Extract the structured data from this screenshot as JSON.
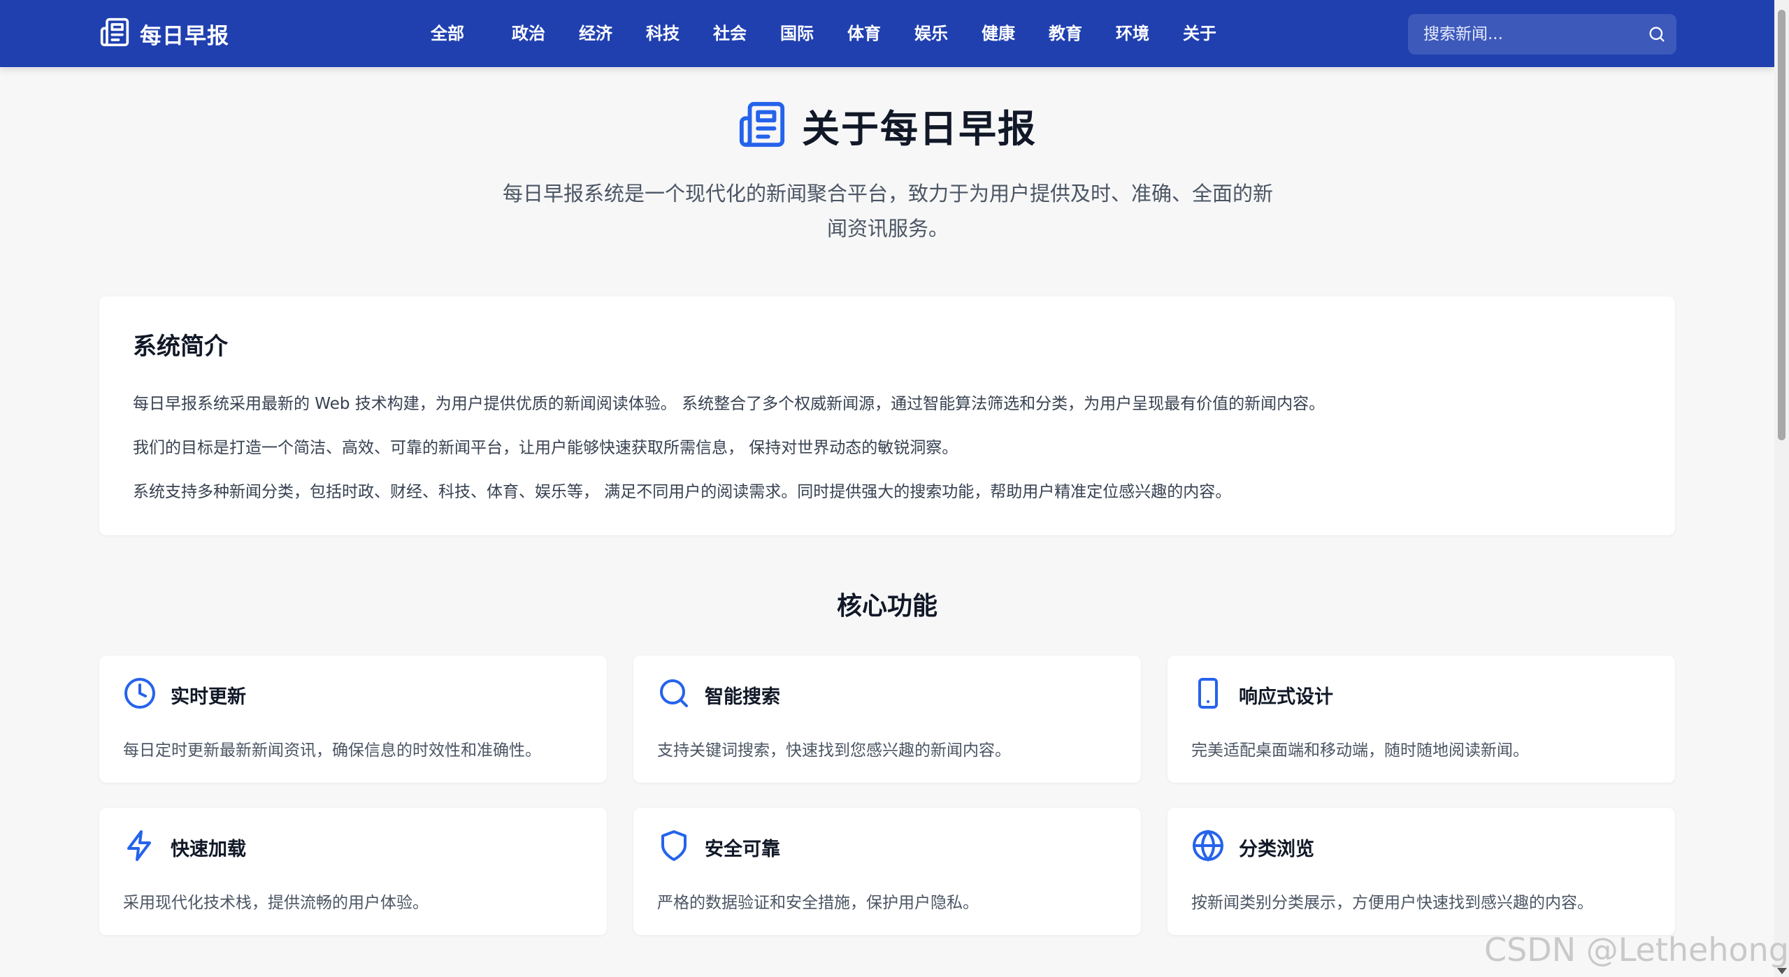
{
  "header": {
    "brand": "每日早报",
    "nav": [
      "全部",
      "政治",
      "经济",
      "科技",
      "社会",
      "国际",
      "体育",
      "娱乐",
      "健康",
      "教育",
      "环境",
      "关于"
    ],
    "search_placeholder": "搜索新闻..."
  },
  "hero": {
    "title": "关于每日早报",
    "description_line1": "每日早报系统是一个现代化的新闻聚合平台，致力于为用户提供及时、准确、全面的新",
    "description_line2": "闻资讯服务。"
  },
  "intro": {
    "title": "系统简介",
    "paragraphs": [
      "每日早报系统采用最新的 Web 技术构建，为用户提供优质的新闻阅读体验。 系统整合了多个权威新闻源，通过智能算法筛选和分类，为用户呈现最有价值的新闻内容。",
      "我们的目标是打造一个简洁、高效、可靠的新闻平台，让用户能够快速获取所需信息， 保持对世界动态的敏锐洞察。",
      "系统支持多种新闻分类，包括时政、财经、科技、体育、娱乐等， 满足不同用户的阅读需求。同时提供强大的搜索功能，帮助用户精准定位感兴趣的内容。"
    ]
  },
  "features": {
    "title": "核心功能",
    "items": [
      {
        "icon": "clock-icon",
        "title": "实时更新",
        "desc": "每日定时更新最新新闻资讯，确保信息的时效性和准确性。"
      },
      {
        "icon": "search-icon",
        "title": "智能搜索",
        "desc": "支持关键词搜索，快速找到您感兴趣的新闻内容。"
      },
      {
        "icon": "mobile-icon",
        "title": "响应式设计",
        "desc": "完美适配桌面端和移动端，随时随地阅读新闻。"
      },
      {
        "icon": "lightning-icon",
        "title": "快速加载",
        "desc": "采用现代化技术栈，提供流畅的用户体验。"
      },
      {
        "icon": "shield-icon",
        "title": "安全可靠",
        "desc": "严格的数据验证和安全措施，保护用户隐私。"
      },
      {
        "icon": "globe-icon",
        "title": "分类浏览",
        "desc": "按新闻类别分类展示，方便用户快速找到感兴趣的内容。"
      }
    ]
  },
  "colors": {
    "primary": "#2040b0",
    "accent_icon": "#2563eb"
  },
  "watermark": "CSDN @Lethehong"
}
